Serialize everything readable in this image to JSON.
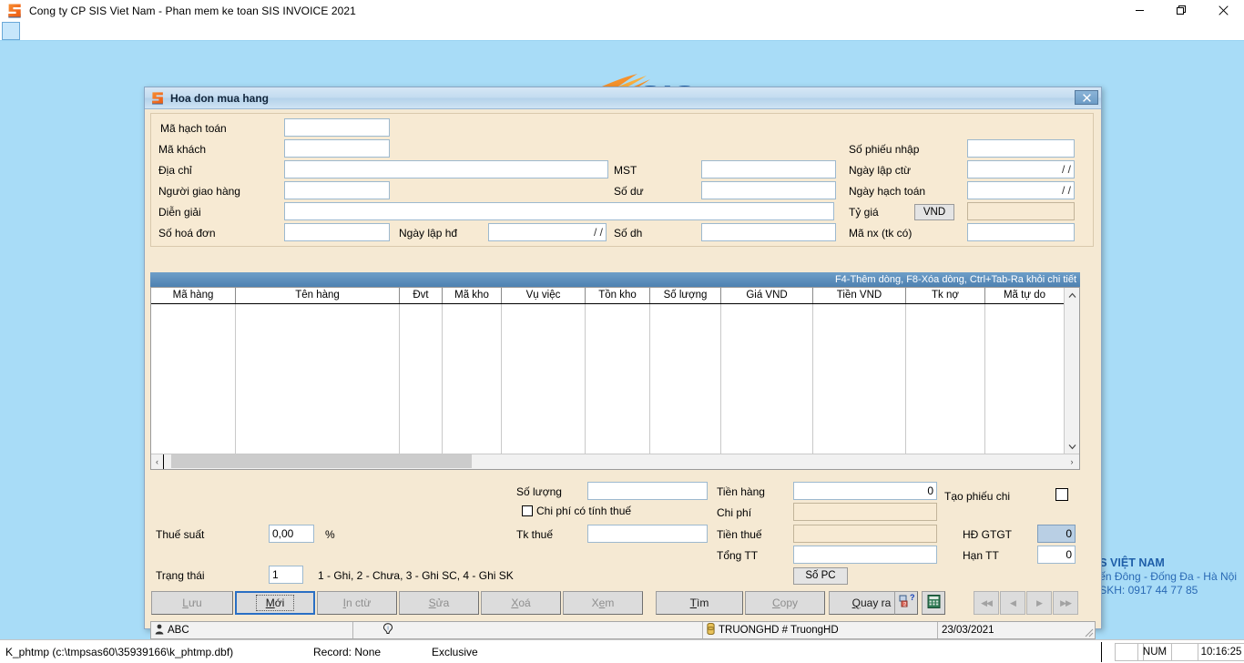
{
  "app": {
    "title": "Cong ty CP SIS Viet Nam - Phan mem ke toan SIS INVOICE 2021",
    "icon": "sis-logo-icon",
    "minimize_label": "—",
    "maximize_label": "❐",
    "close_label": "✕"
  },
  "background": {
    "brand_name": "SIS",
    "company": "S VIỆT NAM",
    "address": "ến Đông - Đống Đa - Hà Nội",
    "phone": "SKH: 0917 44 77 85"
  },
  "dialog": {
    "title": "Hoa don mua hang",
    "icon": "sis-logo-icon",
    "close_label": "✕"
  },
  "header_form": {
    "left": [
      {
        "label": "Mã hạch toán",
        "value": ""
      },
      {
        "label": "Mã khách",
        "value": ""
      },
      {
        "label": "Địa chỉ",
        "value": ""
      },
      {
        "label": "Người giao hàng",
        "value": ""
      },
      {
        "label": "Diễn giải",
        "value": ""
      },
      {
        "label": "Số hoá đơn",
        "value": ""
      }
    ],
    "mid": [
      {
        "label": "Ngày lập hđ",
        "value": "/ /"
      },
      {
        "label": "MST",
        "value": ""
      },
      {
        "label": "Số dư",
        "value": ""
      },
      {
        "label": "Số dh",
        "value": ""
      }
    ],
    "right": [
      {
        "label": "Số phiếu nhập",
        "value": ""
      },
      {
        "label": "Ngày lập ctừ",
        "value": "/ /"
      },
      {
        "label": "Ngày hạch toán",
        "value": "/ /"
      },
      {
        "label": "Tỷ giá",
        "value": ""
      },
      {
        "label": "Mã nx (tk có)",
        "value": ""
      }
    ],
    "currency_button": "VND"
  },
  "hint_bar": {
    "text": "F4-Thêm dòng, F8-Xóa dòng, Ctrl+Tab-Ra khỏi chi tiết"
  },
  "grid": {
    "columns": [
      {
        "label": "Mã hàng",
        "width": 93
      },
      {
        "label": "Tên hàng",
        "width": 180
      },
      {
        "label": "Đvt",
        "width": 47
      },
      {
        "label": "Mã kho",
        "width": 65
      },
      {
        "label": "Vụ việc",
        "width": 92
      },
      {
        "label": "Tồn kho",
        "width": 71
      },
      {
        "label": "Số lượng",
        "width": 78
      },
      {
        "label": "Giá VND",
        "width": 101
      },
      {
        "label": "Tiền VND",
        "width": 102
      },
      {
        "label": "Tk nợ",
        "width": 87
      },
      {
        "label": "Mã tự do",
        "width": 87
      }
    ],
    "rows": [],
    "vscroll_up": "⌃",
    "vscroll_down": "⌄",
    "hscroll_left": "‹",
    "hscroll_right": "›"
  },
  "totals": {
    "so_luong_label": "Số lượng",
    "so_luong_value": "",
    "chi_phi_co_tinh_thue_label": "Chi phí có tính thuế",
    "chi_phi_co_tinh_thue_checked": false,
    "tk_thue_label": "Tk thuế",
    "tk_thue_value": "",
    "tien_hang_label": "Tiền hàng",
    "tien_hang_value": "0",
    "chi_phi_label": "Chi phí",
    "chi_phi_value": "",
    "tien_thue_label": "Tiền thuế",
    "tien_thue_value": "",
    "tong_tt_label": "Tổng TT",
    "tong_tt_value": "",
    "so_pc_button": "Số PC",
    "thue_suat_label": "Thuế suất",
    "thue_suat_value": "0,00",
    "percent_label": "%",
    "trang_thai_label": "Trạng thái",
    "trang_thai_value": "1",
    "trang_thai_hint": "1 - Ghi, 2 - Chưa, 3 - Ghi SC, 4 - Ghi SK",
    "tao_phieu_chi_label": "Tạo phiếu chi",
    "tao_phieu_chi_checked": false,
    "hd_gtgt_label": "HĐ GTGT",
    "hd_gtgt_value": "0",
    "han_tt_label": "Hạn TT",
    "han_tt_value": "0"
  },
  "buttons": [
    {
      "name": "luu",
      "label": "Lưu",
      "accel": "L",
      "state": "disabled"
    },
    {
      "name": "moi",
      "label": "Mới",
      "accel": "M",
      "state": "focused"
    },
    {
      "name": "inctu",
      "label": "In ctừ",
      "accel": "I",
      "state": "disabled"
    },
    {
      "name": "sua",
      "label": "Sửa",
      "accel": "S",
      "state": "disabled"
    },
    {
      "name": "xoa",
      "label": "Xoá",
      "accel": "X",
      "state": "disabled"
    },
    {
      "name": "xem",
      "label": "Xem",
      "accel": "e",
      "state": "disabled"
    },
    {
      "name": "tim",
      "label": "Tìm",
      "accel": "T",
      "state": "normal"
    },
    {
      "name": "copy",
      "label": "Copy",
      "accel": "C",
      "state": "disabled"
    },
    {
      "name": "quayra",
      "label": "Quay ra",
      "accel": "Q",
      "state": "normal"
    }
  ],
  "icon_buttons": [
    {
      "name": "help-query-icon"
    },
    {
      "name": "calculator-icon"
    }
  ],
  "nav_buttons": [
    {
      "name": "first-record",
      "label": "◀◀"
    },
    {
      "name": "prev-record",
      "label": "◀"
    },
    {
      "name": "next-record",
      "label": "▶"
    },
    {
      "name": "last-record",
      "label": "▶▶"
    }
  ],
  "child_status": {
    "user": "ABC",
    "user_icon": "user-icon",
    "info_icon": "info-icon",
    "db": "TRUONGHD # TruongHD",
    "db_icon": "database-icon",
    "date": "23/03/2021"
  },
  "main_status": {
    "table": "K_phtmp (c:\\tmpsas60\\35939166\\k_phtmp.dbf)",
    "record": "Record: None",
    "mode": "Exclusive",
    "num": "NUM",
    "time": "10:16:25"
  }
}
